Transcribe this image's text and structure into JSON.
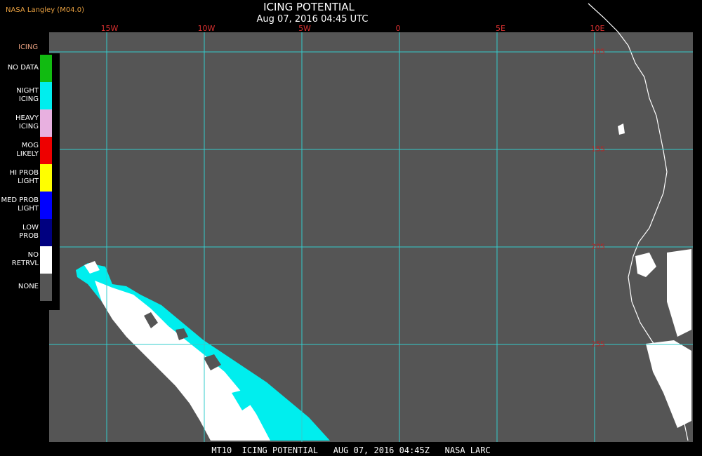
{
  "header": {
    "source": "NASA Langley (M04.0)",
    "title": "ICING POTENTIAL",
    "datetime": "Aug 07, 2016 04:45 UTC"
  },
  "map": {
    "longitude_labels": [
      "15W",
      "10W",
      "5W",
      "0",
      "5E",
      "10E"
    ],
    "latitude_labels": [
      "25S",
      "20S",
      "15S",
      "10S"
    ],
    "grid_color": "#33cccc",
    "background_color": "#555555"
  },
  "legend": {
    "title": "ICING",
    "items": [
      {
        "label": "NO DATA",
        "color": "#11bb11"
      },
      {
        "label": "NIGHT\nICING",
        "color": "#00eeee"
      },
      {
        "label": "HEAVY\nICING",
        "color": "#e8b0e0"
      },
      {
        "label": "MOG\nLIKELY",
        "color": "#ee0000"
      },
      {
        "label": "HI PROB\nLIGHT",
        "color": "#ffff00"
      },
      {
        "label": "MED PROB\nLIGHT",
        "color": "#0000ff"
      },
      {
        "label": "LOW\nPROB",
        "color": "#000080"
      },
      {
        "label": "NO\nRETRVL",
        "color": "#ffffff"
      },
      {
        "label": "NONE",
        "color": "#555555"
      }
    ]
  },
  "footer": {
    "text": "MT10  ICING POTENTIAL   AUG 07, 2016 04:45Z   NASA LARC"
  }
}
